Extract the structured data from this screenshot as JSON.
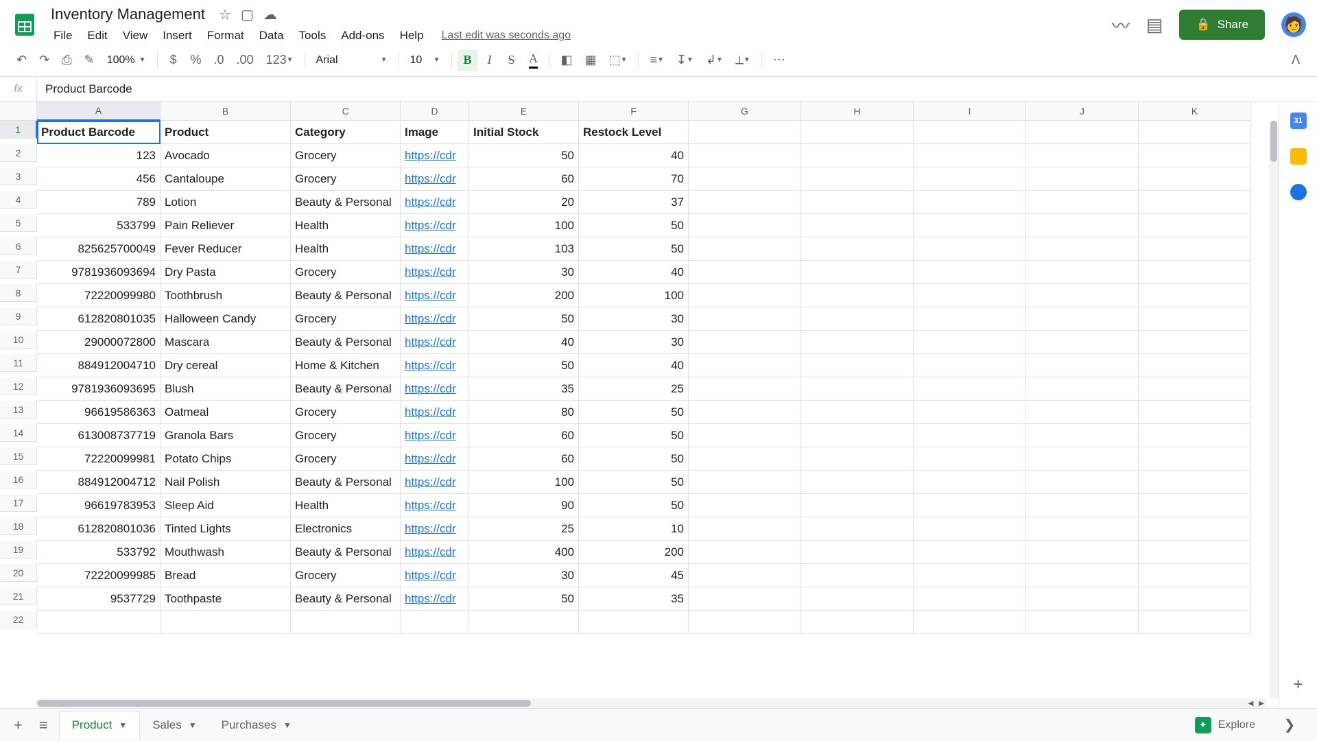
{
  "doc": {
    "title": "Inventory Management",
    "last_edit": "Last edit was seconds ago"
  },
  "menus": [
    "File",
    "Edit",
    "View",
    "Insert",
    "Format",
    "Data",
    "Tools",
    "Add-ons",
    "Help"
  ],
  "share_label": "Share",
  "toolbar": {
    "zoom": "100%",
    "font": "Arial",
    "font_size": "10"
  },
  "formula": {
    "fx": "fx",
    "value": "Product Barcode"
  },
  "columns": [
    "A",
    "B",
    "C",
    "D",
    "E",
    "F",
    "G",
    "H",
    "I",
    "J",
    "K"
  ],
  "headers": [
    "Product Barcode",
    "Product",
    "Category",
    "Image",
    "Initial Stock",
    "Restock Level"
  ],
  "link_text": "https://cdr",
  "rows": [
    {
      "barcode": "123",
      "product": "Avocado",
      "category": "Grocery",
      "stock": "50",
      "restock": "40"
    },
    {
      "barcode": "456",
      "product": "Cantaloupe",
      "category": "Grocery",
      "stock": "60",
      "restock": "70"
    },
    {
      "barcode": "789",
      "product": "Lotion",
      "category": "Beauty & Personal",
      "stock": "20",
      "restock": "37"
    },
    {
      "barcode": "533799",
      "product": "Pain Reliever",
      "category": "Health",
      "stock": "100",
      "restock": "50"
    },
    {
      "barcode": "825625700049",
      "product": "Fever Reducer",
      "category": "Health",
      "stock": "103",
      "restock": "50"
    },
    {
      "barcode": "9781936093694",
      "product": "Dry Pasta",
      "category": "Grocery",
      "stock": "30",
      "restock": "40"
    },
    {
      "barcode": "72220099980",
      "product": "Toothbrush",
      "category": "Beauty & Personal",
      "stock": "200",
      "restock": "100"
    },
    {
      "barcode": "612820801035",
      "product": "Halloween Candy",
      "category": "Grocery",
      "stock": "50",
      "restock": "30"
    },
    {
      "barcode": "29000072800",
      "product": "Mascara",
      "category": "Beauty & Personal",
      "stock": "40",
      "restock": "30"
    },
    {
      "barcode": "884912004710",
      "product": "Dry cereal",
      "category": "Home & Kitchen",
      "stock": "50",
      "restock": "40"
    },
    {
      "barcode": "9781936093695",
      "product": "Blush",
      "category": "Beauty & Personal",
      "stock": "35",
      "restock": "25"
    },
    {
      "barcode": "96619586363",
      "product": "Oatmeal",
      "category": "Grocery",
      "stock": "80",
      "restock": "50"
    },
    {
      "barcode": "613008737719",
      "product": "Granola Bars",
      "category": "Grocery",
      "stock": "60",
      "restock": "50"
    },
    {
      "barcode": "72220099981",
      "product": "Potato Chips",
      "category": "Grocery",
      "stock": "60",
      "restock": "50"
    },
    {
      "barcode": "884912004712",
      "product": "Nail Polish",
      "category": "Beauty & Personal",
      "stock": "100",
      "restock": "50"
    },
    {
      "barcode": "96619783953",
      "product": "Sleep Aid",
      "category": "Health",
      "stock": "90",
      "restock": "50"
    },
    {
      "barcode": "612820801036",
      "product": "Tinted Lights",
      "category": "Electronics",
      "stock": "25",
      "restock": "10"
    },
    {
      "barcode": "533792",
      "product": "Mouthwash",
      "category": "Beauty & Personal",
      "stock": "400",
      "restock": "200"
    },
    {
      "barcode": "72220099985",
      "product": "Bread",
      "category": "Grocery",
      "stock": "30",
      "restock": "45"
    },
    {
      "barcode": "9537729",
      "product": "Toothpaste",
      "category": "Beauty & Personal",
      "stock": "50",
      "restock": "35"
    }
  ],
  "sheet_tabs": [
    {
      "name": "Product",
      "active": true
    },
    {
      "name": "Sales",
      "active": false
    },
    {
      "name": "Purchases",
      "active": false
    }
  ],
  "explore_label": "Explore",
  "calendar_day": "31"
}
